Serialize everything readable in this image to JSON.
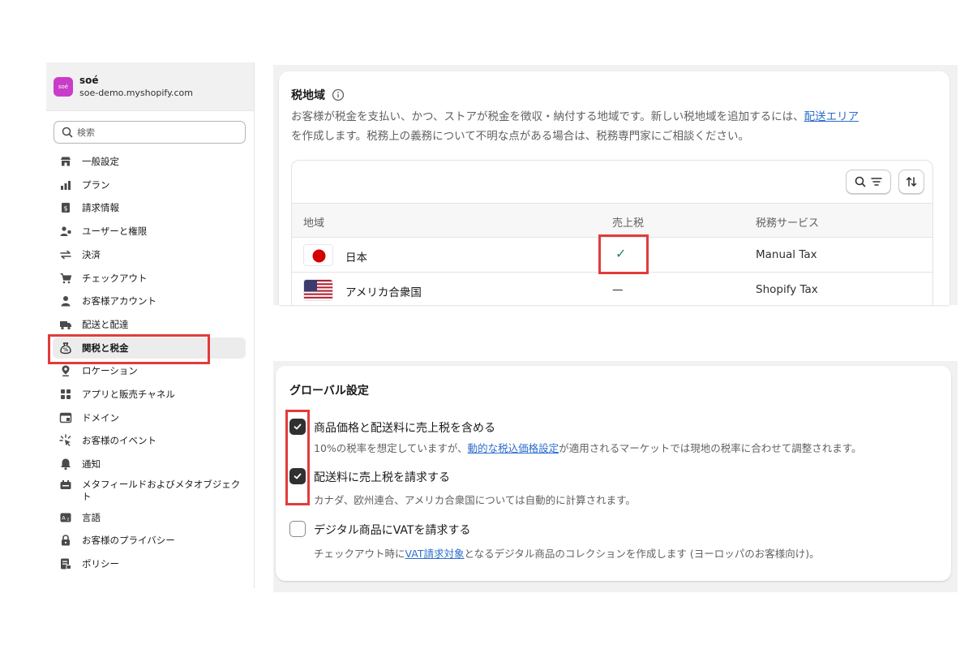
{
  "store": {
    "logo_text": "soé",
    "name": "soé",
    "domain": "soe-demo.myshopify.com"
  },
  "search": {
    "placeholder": "検索"
  },
  "sidebar": {
    "items": [
      {
        "label": "一般設定",
        "icon": "store-icon"
      },
      {
        "label": "プラン",
        "icon": "plan-icon"
      },
      {
        "label": "請求情報",
        "icon": "billing-icon"
      },
      {
        "label": "ユーザーと権限",
        "icon": "users-icon"
      },
      {
        "label": "決済",
        "icon": "payments-icon"
      },
      {
        "label": "チェックアウト",
        "icon": "cart-icon"
      },
      {
        "label": "お客様アカウント",
        "icon": "person-icon"
      },
      {
        "label": "配送と配達",
        "icon": "truck-icon"
      },
      {
        "label": "関税と税金",
        "icon": "tax-icon",
        "active": true
      },
      {
        "label": "ロケーション",
        "icon": "location-icon"
      },
      {
        "label": "アプリと販売チャネル",
        "icon": "apps-icon"
      },
      {
        "label": "ドメイン",
        "icon": "domain-icon"
      },
      {
        "label": "お客様のイベント",
        "icon": "events-icon"
      },
      {
        "label": "通知",
        "icon": "bell-icon"
      },
      {
        "label": "メタフィールドおよびメタオブジェク\nト",
        "icon": "metafields-icon"
      },
      {
        "label": "言語",
        "icon": "language-icon"
      },
      {
        "label": "お客様のプライバシー",
        "icon": "lock-icon"
      },
      {
        "label": "ポリシー",
        "icon": "policy-icon"
      }
    ]
  },
  "tax_regions": {
    "title": "税地域",
    "description_before_link": "お客様が税金を支払い、かつ、ストアが税金を徴収・納付する地域です。新しい税地域を追加するには、",
    "description_link": "配送エリア",
    "description_after_link": "を作成します。税務上の義務について不明な点がある場合は、税務専門家にご相談ください。",
    "columns": [
      "地域",
      "売上税",
      "税務サービス"
    ],
    "rows": [
      {
        "region": "日本",
        "flag": "japan",
        "sales_tax": "✓",
        "service": "Manual Tax"
      },
      {
        "region": "アメリカ合衆国",
        "flag": "usa",
        "sales_tax": "—",
        "service": "Shopify Tax"
      }
    ]
  },
  "global_settings": {
    "title": "グローバル設定",
    "options": [
      {
        "label": "商品価格と配送料に売上税を含める",
        "checked": true,
        "help_before_link": "10%の税率を想定していますが、",
        "help_link": "動的な税込価格設定",
        "help_after_link": "が適用されるマーケットでは現地の税率に合わせて調整されます。"
      },
      {
        "label": "配送料に売上税を請求する",
        "checked": true,
        "help_before_link": "カナダ、欧州連合、アメリカ合衆国については自動的に計算されます。",
        "help_link": "",
        "help_after_link": ""
      },
      {
        "label": "デジタル商品にVATを請求する",
        "checked": false,
        "help_before_link": "チェックアウト時に",
        "help_link": "VAT請求対象",
        "help_after_link": "となるデジタル商品のコレクションを作成します (ヨーロッパのお客様向け)。"
      }
    ]
  },
  "colors": {
    "highlight": "#e23b3b",
    "link": "#2c6ecb",
    "check": "#29845a",
    "logo": "#c93cc9"
  }
}
